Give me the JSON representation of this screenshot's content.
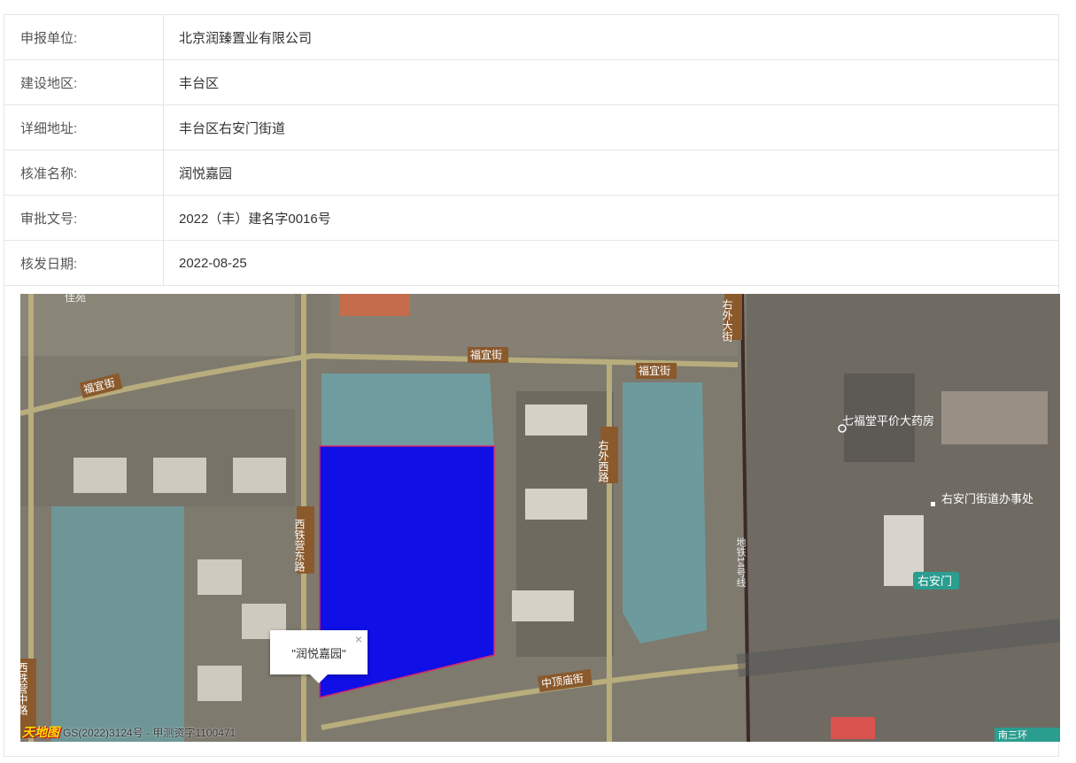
{
  "rows": [
    {
      "label": "申报单位:",
      "value": "北京润臻置业有限公司"
    },
    {
      "label": "建设地区:",
      "value": "丰台区"
    },
    {
      "label": "详细地址:",
      "value": "丰台区右安门街道"
    },
    {
      "label": "核准名称:",
      "value": "润悦嘉园"
    },
    {
      "label": "审批文号:",
      "value": "2022（丰）建名字0016号"
    },
    {
      "label": "核发日期:",
      "value": "2022-08-25"
    }
  ],
  "map": {
    "popup_text": "\"润悦嘉园\"",
    "close_glyph": "×",
    "logo_text": "天地图",
    "attribution": "GS(2022)3124号 - 甲测资字1100471",
    "polygon_color": "#0f0fe6",
    "labels": {
      "fuyi_jie_1": "福宜街",
      "fuyi_jie_2": "福宜街",
      "fuyi_jie_3": "福宜街",
      "youwai_xilu": "右外西路",
      "xitieying_donglu": "西铁营东路",
      "youwai_dajie": "右外大街",
      "zhongding_miao_jie": "中顶庙街",
      "qifutang": "七福堂平价大药房",
      "youanmen_street_office": "右安门街道办事处",
      "youanmen_station": "右安门",
      "xitieying_zhonglu": "西铁营中路",
      "metro_line": "地铁14号线",
      "jiayuan": "佳苑",
      "nansanhuan": "南三环"
    }
  }
}
